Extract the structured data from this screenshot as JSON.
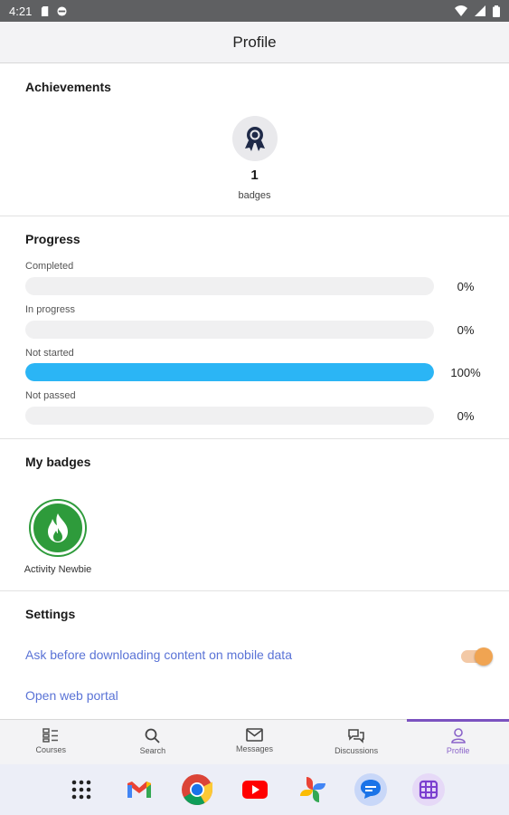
{
  "status_bar": {
    "time": "4:21"
  },
  "app_bar": {
    "title": "Profile"
  },
  "achievements": {
    "title": "Achievements",
    "count": "1",
    "label": "badges"
  },
  "progress": {
    "title": "Progress",
    "rows": [
      {
        "label": "Completed",
        "value": "0%",
        "fraction": 0
      },
      {
        "label": "In progress",
        "value": "0%",
        "fraction": 0
      },
      {
        "label": "Not started",
        "value": "100%",
        "fraction": 1
      },
      {
        "label": "Not passed",
        "value": "0%",
        "fraction": 0
      }
    ],
    "fill_color": "#2bb5f5"
  },
  "my_badges": {
    "title": "My badges",
    "items": [
      {
        "name": "Activity Newbie",
        "color": "#2e9b3b"
      }
    ]
  },
  "settings": {
    "title": "Settings",
    "mobile_data_label": "Ask before downloading content on mobile data",
    "mobile_data_enabled": true,
    "web_portal_label": "Open web portal"
  },
  "tabs": [
    {
      "label": "Courses",
      "icon": "courses-icon",
      "active": false
    },
    {
      "label": "Search",
      "icon": "search-icon",
      "active": false
    },
    {
      "label": "Messages",
      "icon": "mail-icon",
      "active": false
    },
    {
      "label": "Discussions",
      "icon": "discussions-icon",
      "active": false
    },
    {
      "label": "Profile",
      "icon": "profile-icon",
      "active": true
    }
  ],
  "dock_apps": [
    "app-drawer-icon",
    "gmail-icon",
    "chrome-icon",
    "youtube-icon",
    "photos-icon",
    "messages-app-icon",
    "app-icon"
  ],
  "accent_color": "#7b52c0",
  "link_color": "#5a73d6"
}
